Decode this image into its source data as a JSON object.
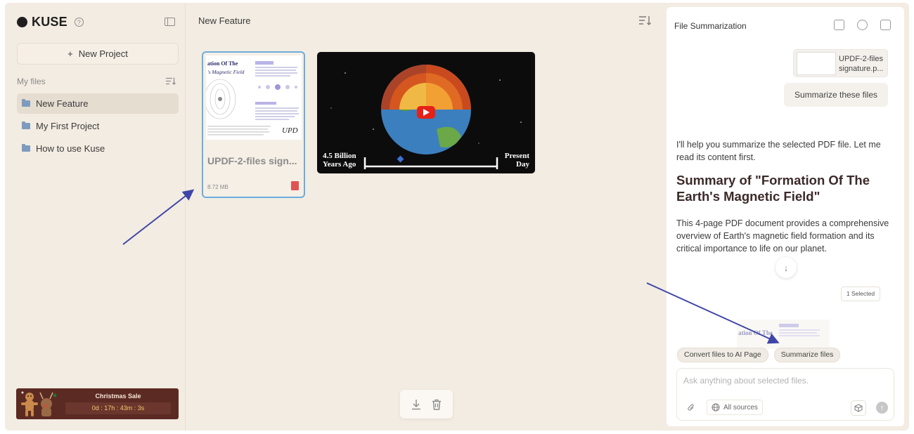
{
  "app": {
    "brand": "KUSE",
    "help_icon": "question-circle-icon"
  },
  "sidebar": {
    "new_project_label": "New Project",
    "my_files_label": "My files",
    "folders": [
      {
        "label": "New Feature",
        "active": true
      },
      {
        "label": "My First Project",
        "active": false
      },
      {
        "label": "How to use Kuse",
        "active": false
      }
    ],
    "promo": {
      "title": "Christmas Sale",
      "timer": "0d : 17h : 43m : 3s"
    }
  },
  "main": {
    "title": "New Feature",
    "pdf_file": {
      "name": "UPDF-2-files sign...",
      "size": "8.72 MB",
      "thumb_heading": "ation Of The",
      "thumb_subheading": "'s Magnetic Field",
      "thumb_logo": "UPD"
    },
    "video": {
      "left_caption_line1": "4.5 Billion",
      "left_caption_line2": "Years Ago",
      "right_caption_line1": "Present",
      "right_caption_line2": "Day"
    }
  },
  "panel": {
    "title": "File Summarization",
    "attachment_name": "UPDF-2-files signature.p...",
    "user_message": "Summarize these files",
    "ai_intro": "I'll help you summarize the selected PDF file. Let me read its content first.",
    "ai_heading": "Summary of \"Formation Of The Earth's Magnetic Field\"",
    "ai_body": "This 4-page PDF document provides a comprehensive overview of Earth's magnetic field formation and its critical importance to life on our planet.",
    "selected_badge": "1 Selected",
    "suggestions": [
      "Convert files to AI Page",
      "Summarize files"
    ],
    "input_placeholder": "Ask anything about selected files.",
    "sources_label": "All sources"
  },
  "colors": {
    "app_bg": "#f3ece2",
    "selection_border": "#6aaedf",
    "annotation_arrow": "#3f46a8",
    "promo_bg": "#5b2a23",
    "heading_text": "#3b2a28"
  }
}
